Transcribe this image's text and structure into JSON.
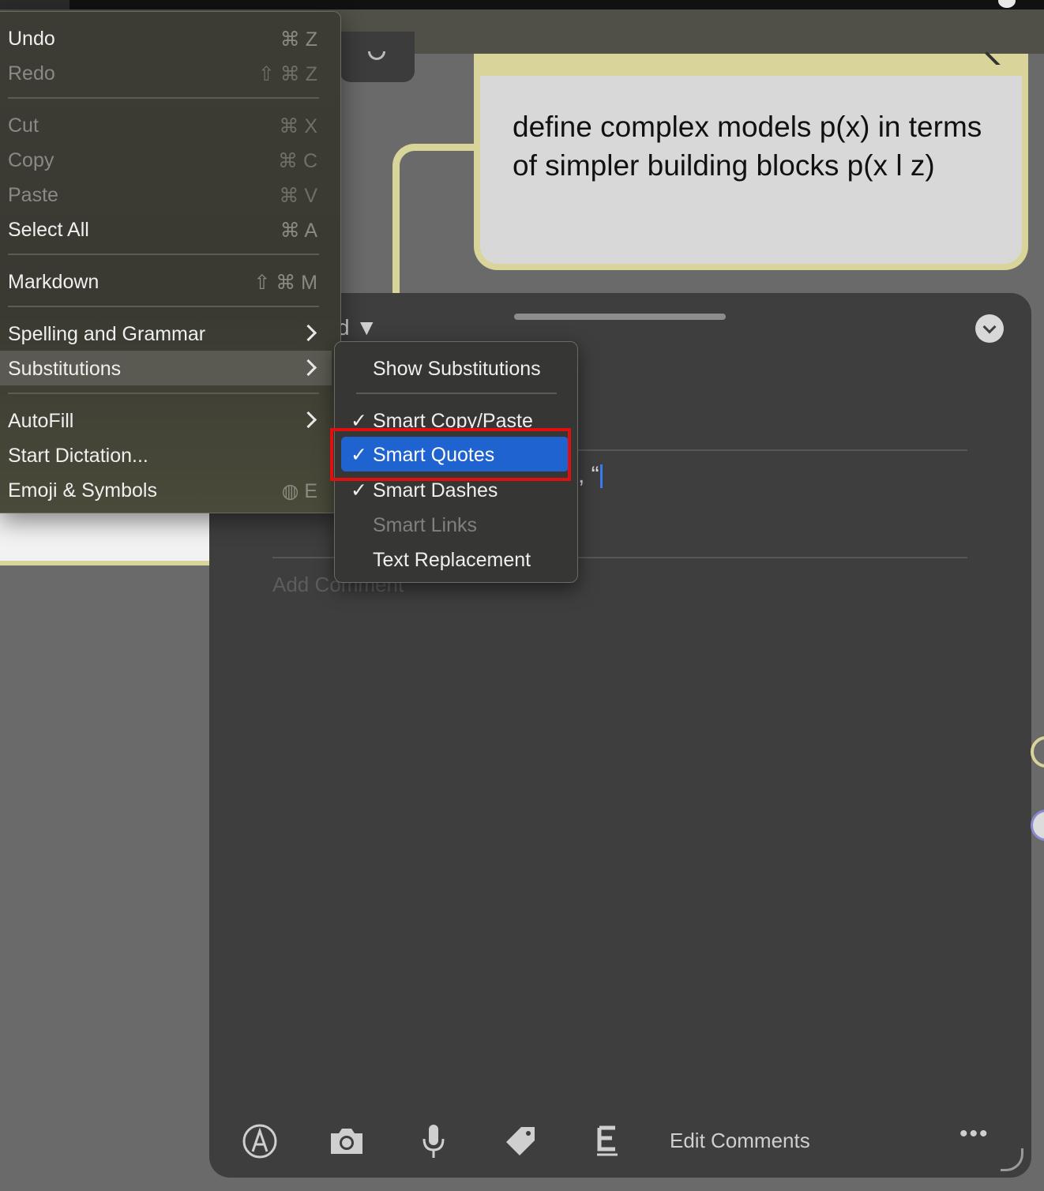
{
  "note": {
    "text": "define complex models p(x) in terms of simpler building blocks p(x l z)"
  },
  "panel": {
    "title_fragment": "d ▼",
    "typed_fragment": ", “",
    "comment_placeholder": "Add Comment",
    "edit_comments_label": "Edit Comments",
    "more_label": "•••"
  },
  "edit_menu": {
    "items": [
      {
        "label": "Undo",
        "shortcut": "⌘ Z",
        "enabled": true
      },
      {
        "label": "Redo",
        "shortcut": "⇧ ⌘ Z",
        "enabled": false
      },
      {
        "label": "Cut",
        "shortcut": "⌘ X",
        "enabled": false
      },
      {
        "label": "Copy",
        "shortcut": "⌘ C",
        "enabled": false
      },
      {
        "label": "Paste",
        "shortcut": "⌘ V",
        "enabled": false
      },
      {
        "label": "Select All",
        "shortcut": "⌘ A",
        "enabled": true
      },
      {
        "label": "Markdown",
        "shortcut": "⇧ ⌘ M",
        "enabled": true
      },
      {
        "label": "Spelling and Grammar",
        "submenu": true,
        "enabled": true
      },
      {
        "label": "Substitutions",
        "submenu": true,
        "enabled": true,
        "active": true
      },
      {
        "label": "AutoFill",
        "submenu": true,
        "enabled": true
      },
      {
        "label": "Start Dictation...",
        "enabled": true
      },
      {
        "label": "Emoji & Symbols",
        "shortcut": "◍ E",
        "enabled": true
      }
    ]
  },
  "substitutions_menu": {
    "items": [
      {
        "label": "Show Substitutions",
        "checked": false,
        "enabled": true
      },
      {
        "label": "Smart Copy/Paste",
        "checked": true,
        "enabled": true
      },
      {
        "label": "Smart Quotes",
        "checked": true,
        "enabled": true,
        "selected": true
      },
      {
        "label": "Smart Dashes",
        "checked": true,
        "enabled": true
      },
      {
        "label": "Smart Links",
        "checked": false,
        "enabled": false
      },
      {
        "label": "Text Replacement",
        "checked": false,
        "enabled": true
      }
    ],
    "check_glyph": "✓"
  },
  "toolbar_icons": [
    "markup-icon",
    "camera-icon",
    "microphone-icon",
    "tag-icon",
    "text-format-icon"
  ],
  "colors": {
    "accent_selection": "#1f63d0",
    "highlight_box": "#e01010",
    "note_border": "#d9d49a"
  }
}
